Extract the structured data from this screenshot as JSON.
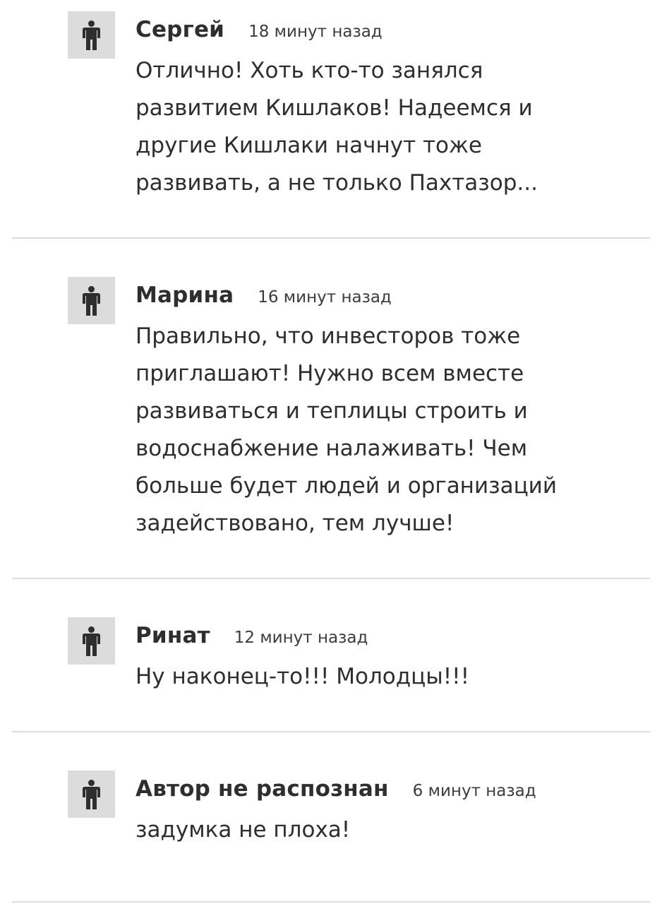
{
  "comments": [
    {
      "author": "Сергей",
      "time": "18 минут назад",
      "text": "Отлично! Хоть кто-то занялся\nразвитием Кишлаков! Надеемся и\nдругие Кишлаки начнут тоже\nразвивать, а не только Пахтазор..."
    },
    {
      "author": "Марина",
      "time": "16 минут назад",
      "text": "Правильно, что инвесторов тоже\nприглашают! Нужно всем вместе\nразвиваться и теплицы строить и\nводоснабжение налаживать! Чем\nбольше будет людей и организаций\nзадействовано, тем лучше!"
    },
    {
      "author": "Ринат",
      "time": "12 минут назад",
      "text": "Ну наконец-то!!! Молодцы!!!"
    },
    {
      "author": "Автор не распознан",
      "time": "6 минут назад",
      "text": "задумка не плоха!"
    }
  ],
  "avatar_icon": "person-icon",
  "colors": {
    "avatar_bg": "#dcdcdc",
    "icon": "#2e2e2e",
    "divider": "#dedede",
    "text": "#2e2e2e"
  }
}
